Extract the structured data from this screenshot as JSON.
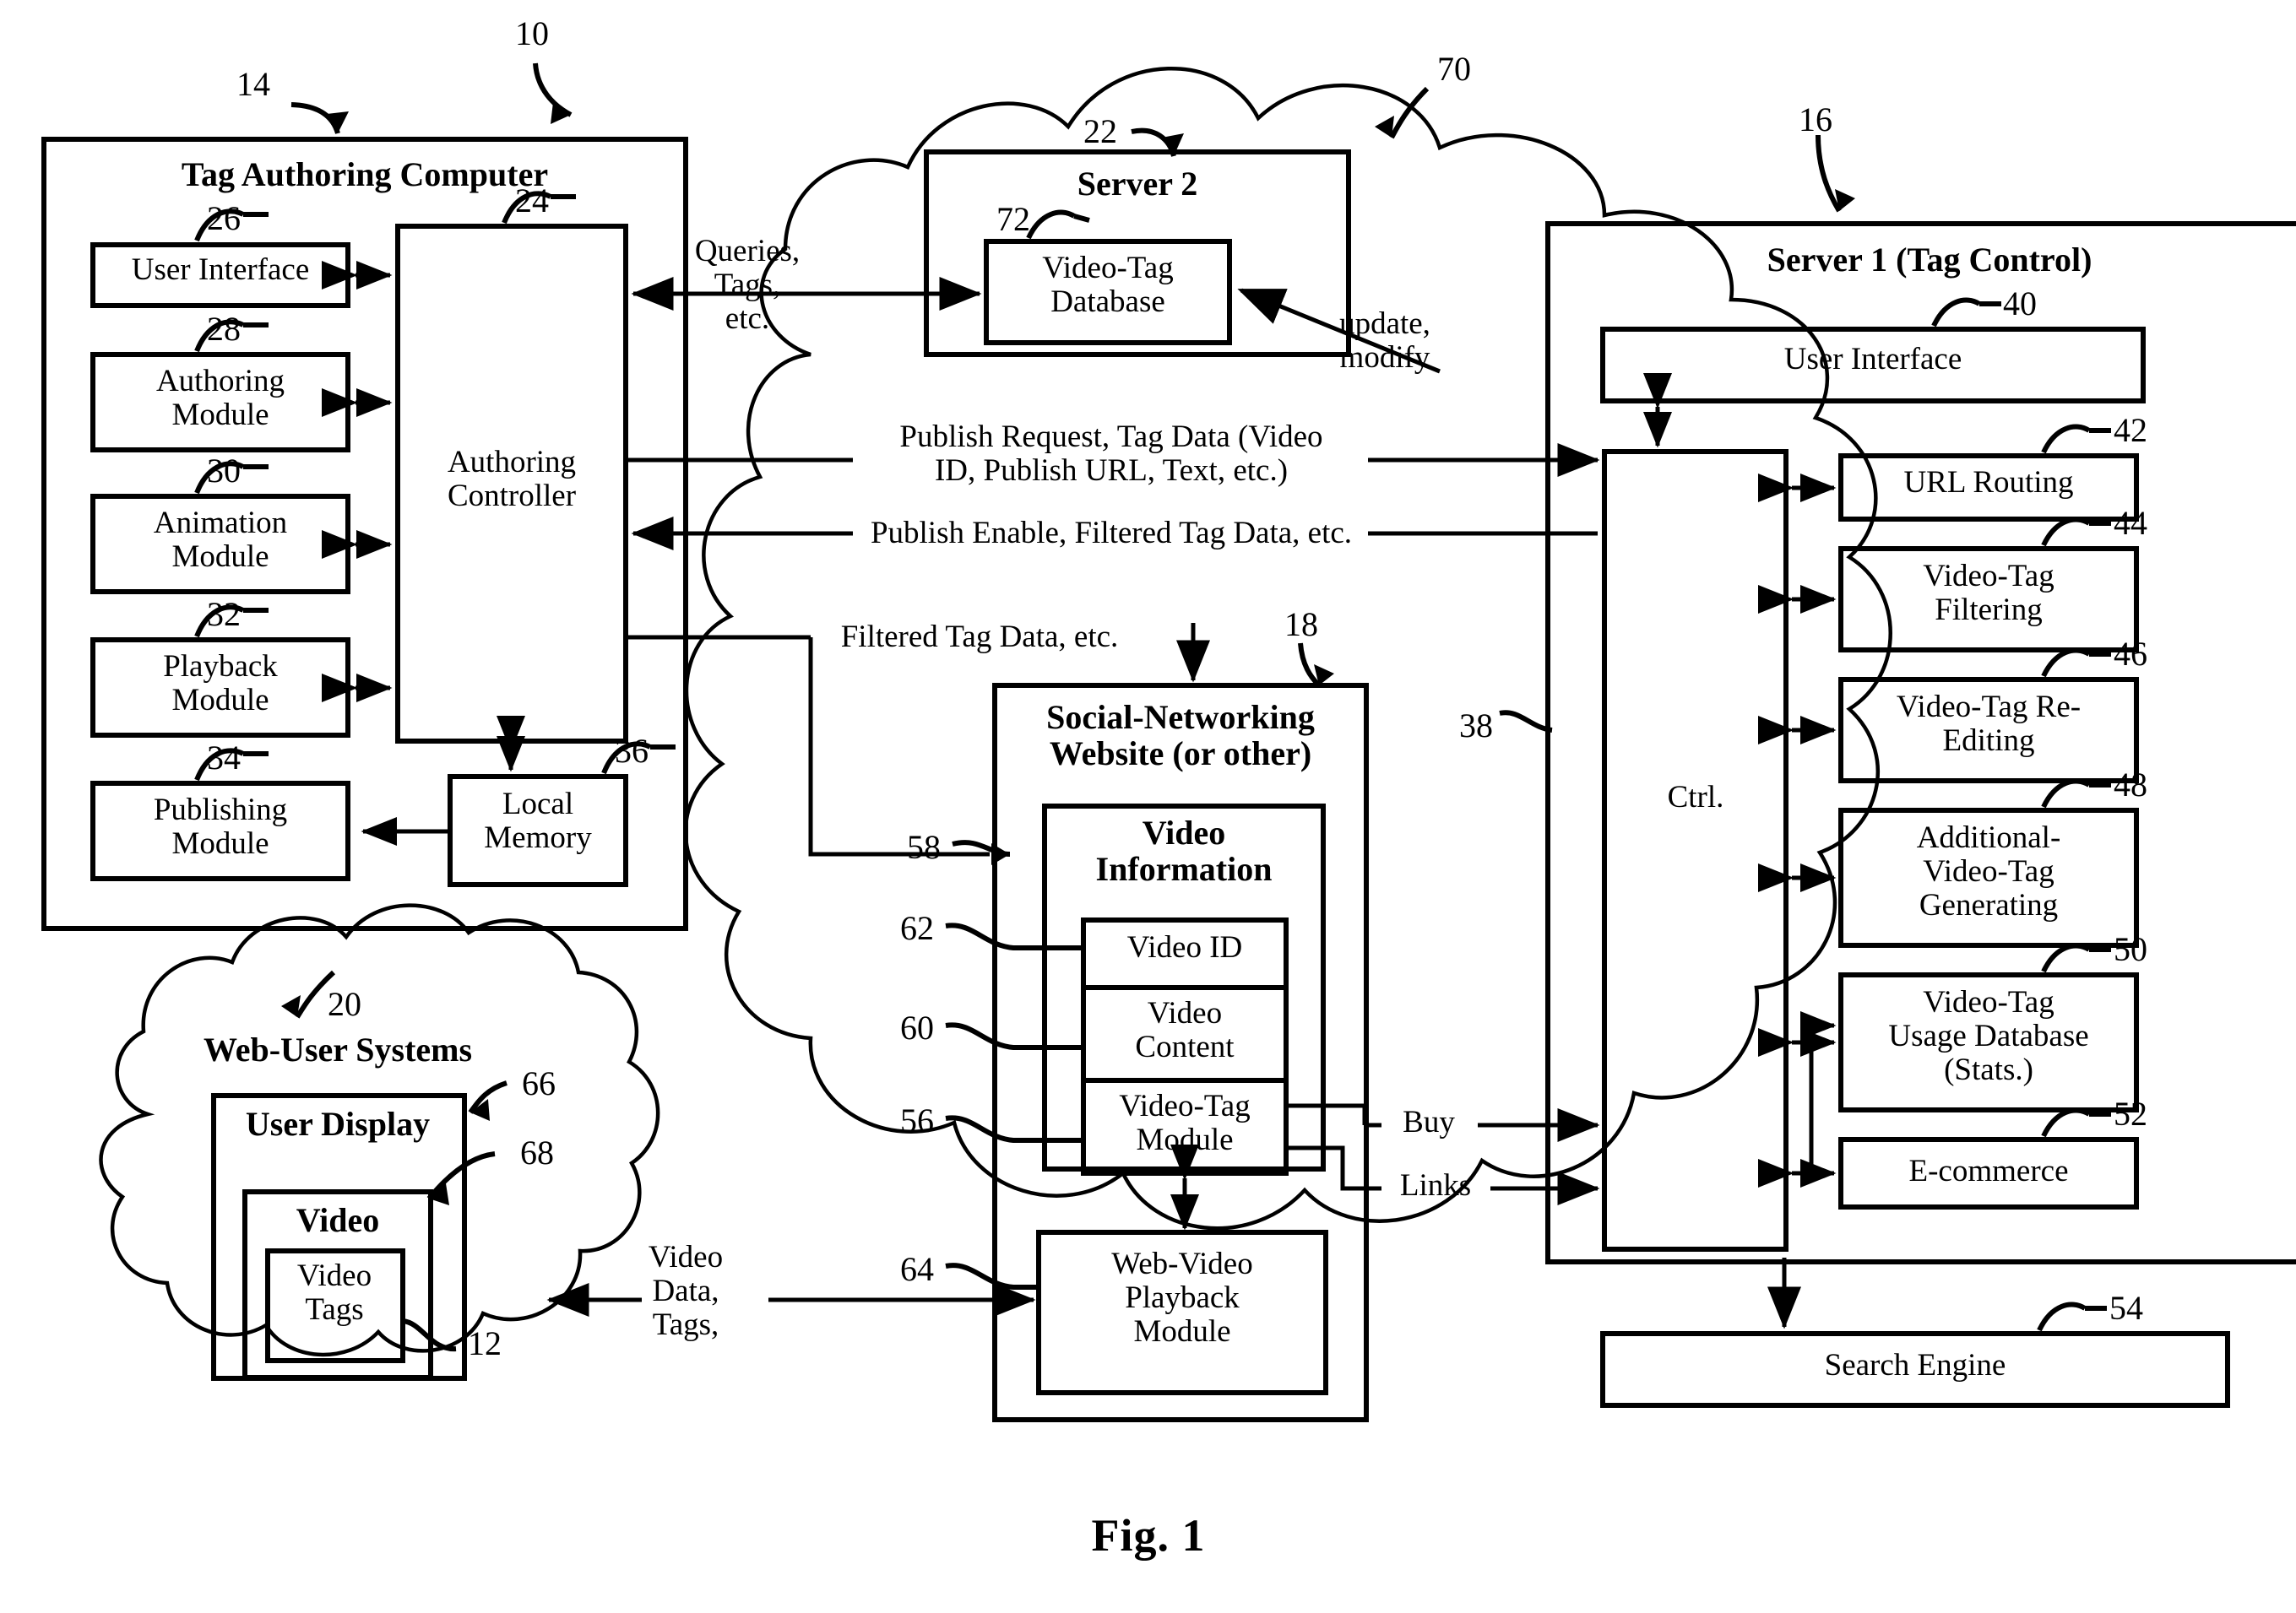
{
  "figure": {
    "caption": "Fig. 1",
    "system_ref": "10"
  },
  "tag_authoring_computer": {
    "ref": "14",
    "title": "Tag Authoring Computer",
    "modules": [
      {
        "ref": "26",
        "label": "User Interface"
      },
      {
        "ref": "28",
        "label": "Authoring\nModule"
      },
      {
        "ref": "30",
        "label": "Animation\nModule"
      },
      {
        "ref": "32",
        "label": "Playback\nModule"
      },
      {
        "ref": "34",
        "label": "Publishing\nModule"
      }
    ],
    "controller": {
      "ref": "24",
      "label": "Authoring\nController"
    },
    "local_memory": {
      "ref": "36",
      "label": "Local\nMemory"
    }
  },
  "server2": {
    "ref": "22",
    "title": "Server 2",
    "database": {
      "ref": "72",
      "label": "Video-Tag\nDatabase"
    }
  },
  "network_cloud": {
    "ref": "70"
  },
  "server1": {
    "ref": "16",
    "title": "Server 1 (Tag Control)",
    "user_interface": {
      "ref": "40",
      "label": "User Interface"
    },
    "ctrl": {
      "ref": "38",
      "label": "Ctrl."
    },
    "modules": [
      {
        "ref": "42",
        "label": "URL Routing"
      },
      {
        "ref": "44",
        "label": "Video-Tag\nFiltering"
      },
      {
        "ref": "46",
        "label": "Video-Tag Re-\nEditing"
      },
      {
        "ref": "48",
        "label": "Additional-\nVideo-Tag\nGenerating"
      },
      {
        "ref": "50",
        "label": "Video-Tag\nUsage Database\n(Stats.)"
      },
      {
        "ref": "52",
        "label": "E-commerce"
      }
    ],
    "search_engine": {
      "ref": "54",
      "label": "Search Engine"
    }
  },
  "social_site": {
    "ref": "18",
    "title": "Social-Networking\nWebsite (or other)",
    "video_information": {
      "ref": "58",
      "label": "Video\nInformation"
    },
    "items": [
      {
        "ref": "62",
        "label": "Video ID"
      },
      {
        "ref": "60",
        "label": "Video\nContent"
      },
      {
        "ref": "56",
        "label": "Video-Tag\nModule"
      }
    ],
    "playback": {
      "ref": "64",
      "label": "Web-Video\nPlayback\nModule"
    }
  },
  "web_user_systems": {
    "ref": "20",
    "title": "Web-User Systems",
    "user_display": {
      "ref": "66",
      "label": "User Display"
    },
    "video": {
      "ref": "68",
      "label": "Video"
    },
    "video_tags": {
      "ref": "12",
      "label": "Video\nTags"
    }
  },
  "flow_labels": {
    "queries": "Queries,\nTags,\netc.",
    "update_modify": "update,\nmodify",
    "publish_request": "Publish Request, Tag Data (Video\nID, Publish URL, Text, etc.)",
    "publish_enable": "Publish Enable, Filtered Tag Data, etc.",
    "filtered_tag_data": "Filtered Tag Data, etc.",
    "buy": "Buy",
    "links": "Links",
    "video_data_tags": "Video\nData,\nTags,"
  }
}
